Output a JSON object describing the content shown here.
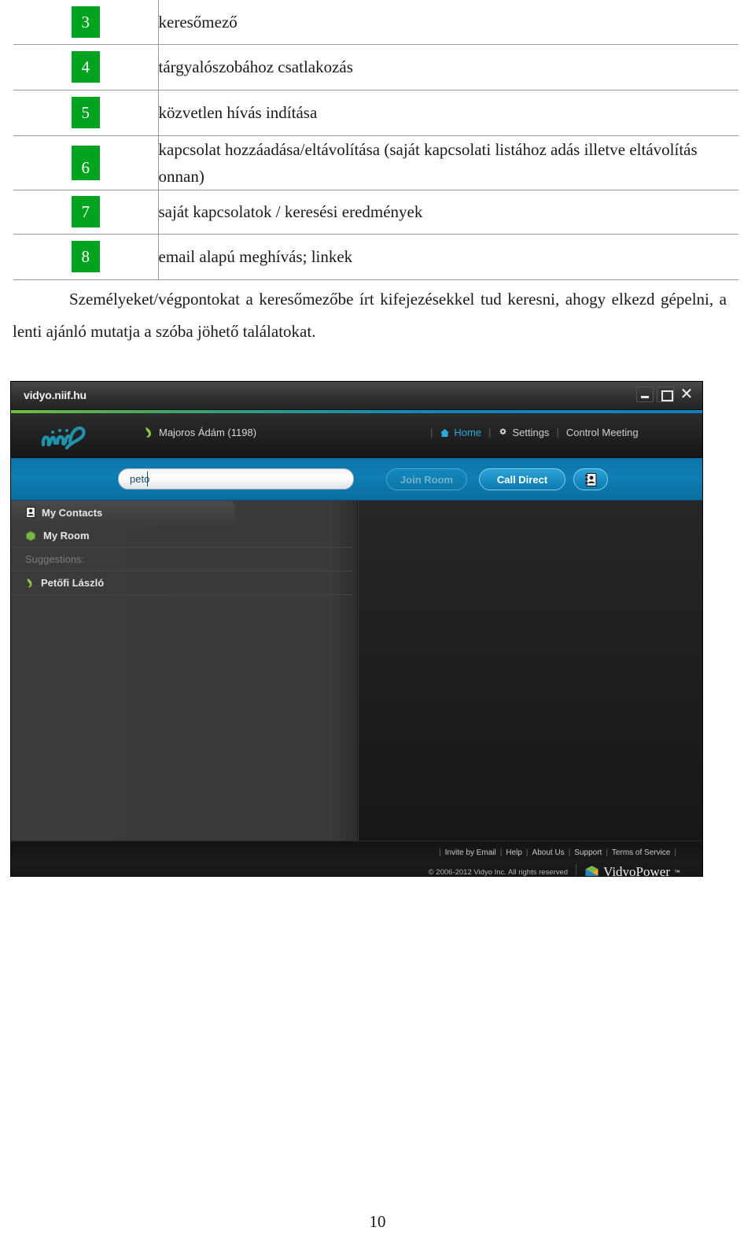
{
  "document": {
    "legend_table": {
      "rows": [
        {
          "number": "3",
          "description": "keresőmező"
        },
        {
          "number": "4",
          "description": "tárgyalószobához csatlakozás"
        },
        {
          "number": "5",
          "description": "közvetlen hívás indítása"
        },
        {
          "number": "6",
          "description": "kapcsolat hozzáadása/eltávolítása (saját kapcsolati listához adás illetve eltávolítás onnan)"
        },
        {
          "number": "7",
          "description": "saját kapcsolatok / keresési eredmények"
        },
        {
          "number": "8",
          "description": "email alapú meghívás; linkek"
        }
      ]
    },
    "paragraph": "Személyeket/végpontokat a keresőmezőbe írt kifejezésekkel tud keresni, ahogy elkezd gépelni, a lenti ajánló mutatja a szóba jöhető találatokat.",
    "page_number": "10"
  },
  "app": {
    "titlebar": {
      "title": "vidyo.niif.hu",
      "minimize_label": "Minimize",
      "maximize_label": "Maximize",
      "close_label": "✕"
    },
    "header": {
      "logo_name": "niif",
      "user": "Majoros Ádám (1198)",
      "nav": [
        {
          "label": "Home",
          "icon": "home-icon",
          "active": true
        },
        {
          "label": "Settings",
          "icon": "gear-icon",
          "active": false
        },
        {
          "label": "Control Meeting",
          "icon": "",
          "active": false
        }
      ]
    },
    "searchbar": {
      "search_value": "peto",
      "search_placeholder": "",
      "join_room_label": "Join Room",
      "call_direct_label": "Call Direct",
      "address_book_label": "Address Book"
    },
    "contacts_panel": {
      "tab_label": "My Contacts",
      "my_room_label": "My Room",
      "suggestions_label": "Suggestions:",
      "suggestions": [
        {
          "name": "Petőfi László"
        }
      ]
    },
    "footer": {
      "links": [
        "Invite by Email",
        "Help",
        "About Us",
        "Support",
        "Terms of Service"
      ],
      "copyright": "© 2006-2012 Vidyo Inc. All rights reserved",
      "brand": "VidyoPower",
      "brand_tm": "™"
    },
    "colors": {
      "badge_green": "#00a31e",
      "search_blue": "#0e7fb6",
      "accent_cyan": "#2fa8e0",
      "panel_grey": "#3b3b3b"
    }
  }
}
